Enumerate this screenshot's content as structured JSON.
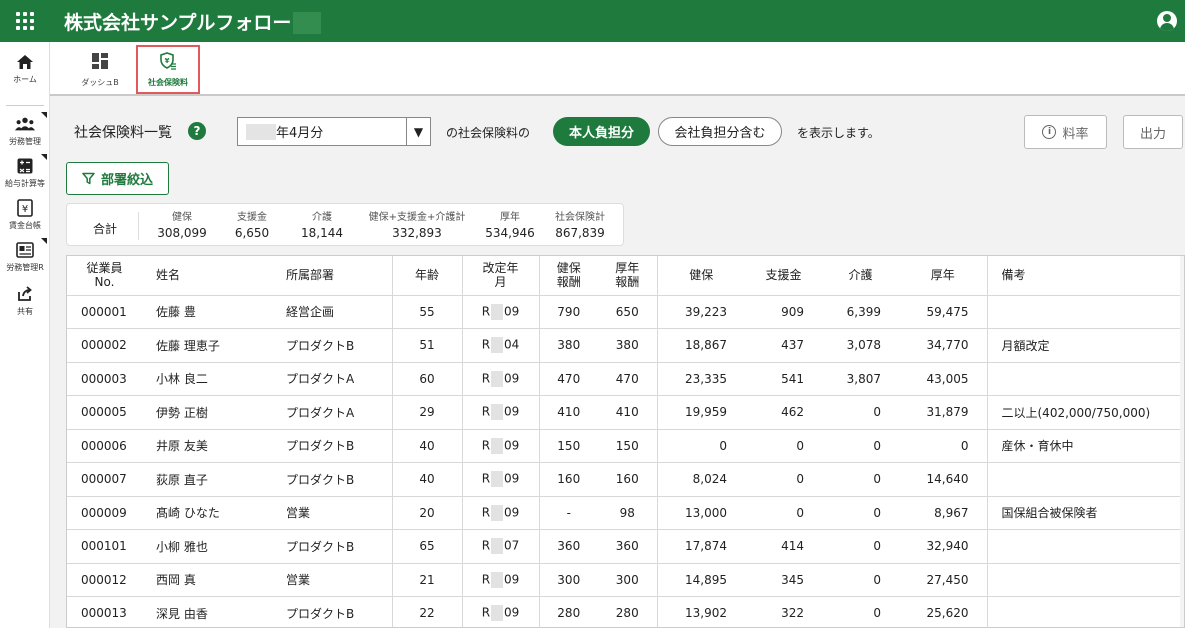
{
  "header": {
    "title": "株式会社サンプルフォロー"
  },
  "leftnav": [
    {
      "label": "ホーム",
      "icon": "home-icon"
    },
    {
      "label": "労務管理",
      "icon": "people-icon"
    },
    {
      "label": "給与計算等",
      "icon": "calculator-icon"
    },
    {
      "label": "賃金台帳",
      "icon": "ledger-icon"
    },
    {
      "label": "労務管理R",
      "icon": "labor-report-icon"
    },
    {
      "label": "共有",
      "icon": "share-icon"
    }
  ],
  "tabs": {
    "dashboard": "ダッシュB",
    "social": "社会保険料"
  },
  "toolbar": {
    "title": "社会保険料一覧",
    "help": "?",
    "month": "年4月分",
    "arrow": "▼",
    "of_label": "の社会保険料の",
    "self_label": "本人負担分",
    "company_label": "会社負担分含む",
    "show_label": "を表示します。",
    "rate_label": "料率",
    "info_glyph": "i",
    "output_label": "出力",
    "filter_label": "部署絞込"
  },
  "summary": {
    "label": "合計",
    "items": [
      {
        "h": "健保",
        "v": "308,099"
      },
      {
        "h": "支援金",
        "v": "6,650"
      },
      {
        "h": "介護",
        "v": "18,144"
      },
      {
        "h": "健保+支援金+介護計",
        "v": "332,893"
      },
      {
        "h": "厚年",
        "v": "534,946"
      },
      {
        "h": "社会保険計",
        "v": "867,839"
      }
    ]
  },
  "table": {
    "headers": {
      "id": [
        "従業員",
        "No."
      ],
      "name": "姓名",
      "dept": "所属部署",
      "age": "年齢",
      "revised": [
        "改定年",
        "月"
      ],
      "hi_pay": [
        "健保",
        "報酬"
      ],
      "pen_pay": [
        "厚年",
        "報酬"
      ],
      "hi": "健保",
      "support": "支援金",
      "care": "介護",
      "pension": "厚年",
      "note": "備考"
    },
    "rows": [
      {
        "id": "000001",
        "name": "佐藤 豊",
        "dept": "経営企画",
        "age": "55",
        "rev_pre": "R",
        "rev_post": "09",
        "hi_pay": "790",
        "pen_pay": "650",
        "hi": "39,223",
        "support": "909",
        "care": "6,399",
        "pension": "59,475",
        "note": ""
      },
      {
        "id": "000002",
        "name": "佐藤 理恵子",
        "dept": "プロダクトB",
        "age": "51",
        "rev_pre": "R",
        "rev_post": "04",
        "hi_pay": "380",
        "pen_pay": "380",
        "hi": "18,867",
        "support": "437",
        "care": "3,078",
        "pension": "34,770",
        "note": "月額改定"
      },
      {
        "id": "000003",
        "name": "小林 良二",
        "dept": "プロダクトA",
        "age": "60",
        "rev_pre": "R",
        "rev_post": "09",
        "hi_pay": "470",
        "pen_pay": "470",
        "hi": "23,335",
        "support": "541",
        "care": "3,807",
        "pension": "43,005",
        "note": ""
      },
      {
        "id": "000005",
        "name": "伊勢 正樹",
        "dept": "プロダクトA",
        "age": "29",
        "rev_pre": "R",
        "rev_post": "09",
        "hi_pay": "410",
        "pen_pay": "410",
        "hi": "19,959",
        "support": "462",
        "care": "0",
        "pension": "31,879",
        "note": "二以上(402,000/750,000)"
      },
      {
        "id": "000006",
        "name": "井原 友美",
        "dept": "プロダクトB",
        "age": "40",
        "rev_pre": "R",
        "rev_post": "09",
        "hi_pay": "150",
        "pen_pay": "150",
        "hi": "0",
        "support": "0",
        "care": "0",
        "pension": "0",
        "note": "産休・育休中"
      },
      {
        "id": "000007",
        "name": "荻原 直子",
        "dept": "プロダクトB",
        "age": "40",
        "rev_pre": "R",
        "rev_post": "09",
        "hi_pay": "160",
        "pen_pay": "160",
        "hi": "8,024",
        "support": "0",
        "care": "0",
        "pension": "14,640",
        "note": ""
      },
      {
        "id": "000009",
        "name": "髙崎 ひなた",
        "dept": "営業",
        "age": "20",
        "rev_pre": "R",
        "rev_post": "09",
        "hi_pay": "-",
        "pen_pay": "98",
        "hi": "13,000",
        "support": "0",
        "care": "0",
        "pension": "8,967",
        "note": "国保組合被保険者"
      },
      {
        "id": "000101",
        "name": "小柳 雅也",
        "dept": "プロダクトB",
        "age": "65",
        "rev_pre": "R",
        "rev_post": "07",
        "hi_pay": "360",
        "pen_pay": "360",
        "hi": "17,874",
        "support": "414",
        "care": "0",
        "pension": "32,940",
        "note": ""
      },
      {
        "id": "000012",
        "name": "西岡 真",
        "dept": "営業",
        "age": "21",
        "rev_pre": "R",
        "rev_post": "09",
        "hi_pay": "300",
        "pen_pay": "300",
        "hi": "14,895",
        "support": "345",
        "care": "0",
        "pension": "27,450",
        "note": ""
      },
      {
        "id": "000013",
        "name": "深見 由香",
        "dept": "プロダクトB",
        "age": "22",
        "rev_pre": "R",
        "rev_post": "09",
        "hi_pay": "280",
        "pen_pay": "280",
        "hi": "13,902",
        "support": "322",
        "care": "0",
        "pension": "25,620",
        "note": ""
      }
    ]
  },
  "colors": {
    "brand": "#1f7a3e",
    "tab_highlight": "#e05a5a"
  }
}
